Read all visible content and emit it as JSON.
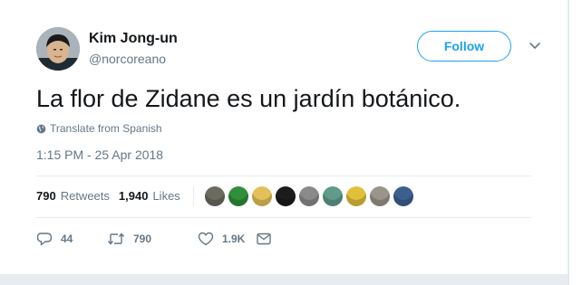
{
  "author": {
    "name": "Kim Jong-un",
    "handle": "@norcoreano"
  },
  "follow_label": "Follow",
  "tweet": {
    "text": "La flor de Zidane es un jardín botánico.",
    "translate_label": "Translate from Spanish",
    "timestamp": "1:15 PM - 25 Apr 2018"
  },
  "stats": {
    "retweets_count": "790",
    "retweets_label": "Retweets",
    "likes_count": "1,940",
    "likes_label": "Likes"
  },
  "liker_avatars": [
    {
      "name": "avatar-1",
      "color": "#6b6b5f"
    },
    {
      "name": "avatar-2",
      "color": "#2f8f3a"
    },
    {
      "name": "avatar-3",
      "color": "#e3c15a"
    },
    {
      "name": "avatar-4",
      "color": "#1c1c1c"
    },
    {
      "name": "avatar-5",
      "color": "#8a8a8a"
    },
    {
      "name": "avatar-6",
      "color": "#5f9a8a"
    },
    {
      "name": "avatar-7",
      "color": "#e0c03a"
    },
    {
      "name": "avatar-8",
      "color": "#9a948a"
    },
    {
      "name": "avatar-9",
      "color": "#3c5f8f"
    }
  ],
  "actions": {
    "reply_count": "44",
    "retweet_count": "790",
    "like_count": "1.9K"
  },
  "colors": {
    "accent": "#1da1f2",
    "muted": "#657786",
    "text": "#14171a"
  }
}
